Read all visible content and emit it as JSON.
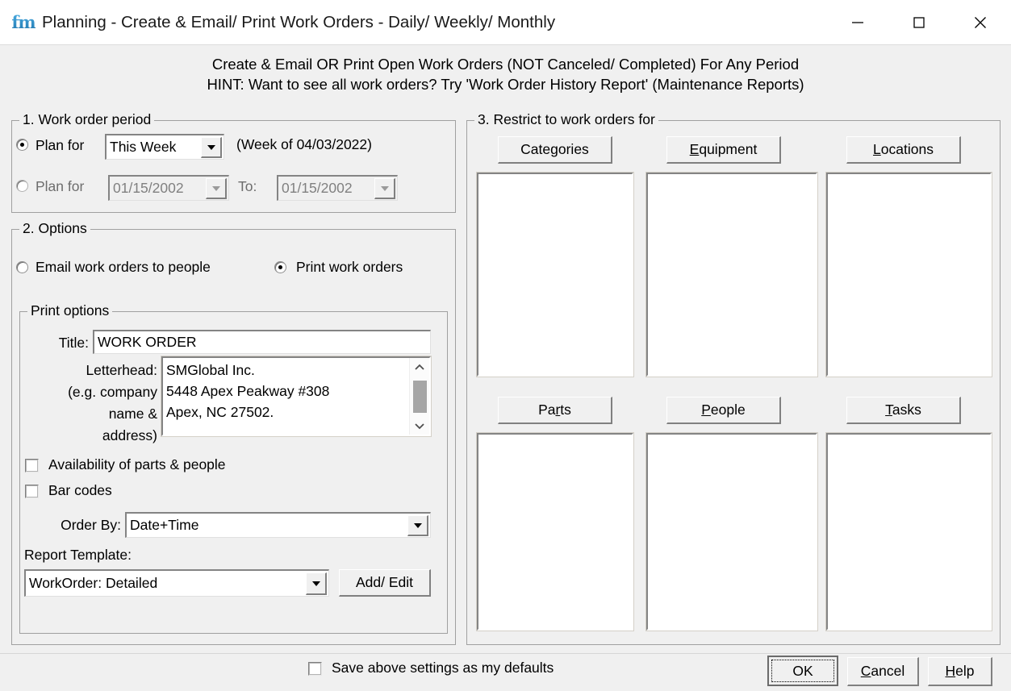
{
  "window": {
    "logo_text": "fm",
    "title": "Planning - Create & Email/ Print Work Orders - Daily/ Weekly/ Monthly",
    "controls": {
      "minimize": "minimize-icon",
      "maximize": "maximize-icon",
      "close": "close-icon"
    }
  },
  "header": {
    "line1": "Create & Email OR Print Open Work Orders (NOT Canceled/ Completed) For Any Period",
    "line2": "HINT: Want to see all work orders? Try 'Work Order History Report' (Maintenance Reports)"
  },
  "period": {
    "legend": "1. Work order period",
    "row1": {
      "label": "Plan for",
      "selected": true,
      "combo_value": "This Week",
      "note": "(Week of 04/03/2022)"
    },
    "row2": {
      "label": "Plan for",
      "selected": false,
      "from_value": "01/15/2002",
      "to_label": "To:",
      "to_value": "01/15/2002",
      "disabled": true
    }
  },
  "options": {
    "legend": "2. Options",
    "email_label": "Email work orders to people",
    "email_selected": false,
    "print_label": "Print work orders",
    "print_selected": true,
    "print_options": {
      "legend": "Print options",
      "title_label": "Title:",
      "title_value": "WORK ORDER",
      "letterhead_label": "Letterhead:",
      "letterhead_hint_line1": "(e.g. company",
      "letterhead_hint_line2": "name &",
      "letterhead_hint_line3": "address)",
      "letterhead_value": "SMGlobal Inc.\n5448 Apex Peakway #308\nApex, NC 27502.",
      "availability_label": "Availability of parts & people",
      "availability_checked": false,
      "barcodes_label": "Bar codes",
      "barcodes_checked": false,
      "orderby_label": "Order By:",
      "orderby_value": "Date+Time",
      "template_label": "Report Template:",
      "template_value": "WorkOrder: Detailed",
      "addedit_label": "Add/ Edit"
    }
  },
  "restrict": {
    "legend": "3. Restrict to work orders for",
    "buttons": [
      {
        "label": "Categories",
        "accel_index": 4,
        "items": []
      },
      {
        "label": "Equipment",
        "accel_index": 0,
        "items": []
      },
      {
        "label": "Locations",
        "accel_index": 0,
        "items": []
      },
      {
        "label": "Parts",
        "accel_index": 2,
        "items": []
      },
      {
        "label": "People",
        "accel_index": 0,
        "items": []
      },
      {
        "label": "Tasks",
        "accel_index": 0,
        "items": []
      }
    ]
  },
  "footer": {
    "save_defaults_label": "Save above settings as my defaults",
    "save_defaults_checked": false,
    "ok_label": "OK",
    "ok_accel_index": 0,
    "cancel_label": "Cancel",
    "cancel_accel_index": 0,
    "help_label": "Help",
    "help_accel_index": 0
  },
  "colors": {
    "dialog_bg": "#f0f0f0",
    "titlebar_bg": "#ffffff",
    "field_bg": "#ffffff",
    "border": "#a0a0a0",
    "logo_blue": "#1a6fa8"
  }
}
